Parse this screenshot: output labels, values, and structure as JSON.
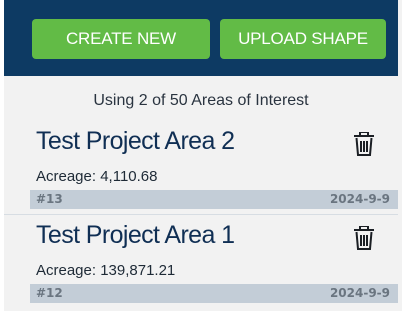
{
  "header": {
    "create_label": "CREATE NEW",
    "upload_label": "UPLOAD SHAPE"
  },
  "usage_text": "Using 2 of 50 Areas of Interest",
  "projects": [
    {
      "name": "Test Project Area 2",
      "acreage": "Acreage: 4,110.68",
      "id": "#13",
      "date": "2024-9-9"
    },
    {
      "name": "Test Project Area 1",
      "acreage": "Acreage: 139,871.21",
      "id": "#12",
      "date": "2024-9-9"
    }
  ],
  "colors": {
    "header_bg": "#0d3a63",
    "button_bg": "#62bb46",
    "meta_bg": "#c3cdd7",
    "title_color": "#102f54"
  }
}
